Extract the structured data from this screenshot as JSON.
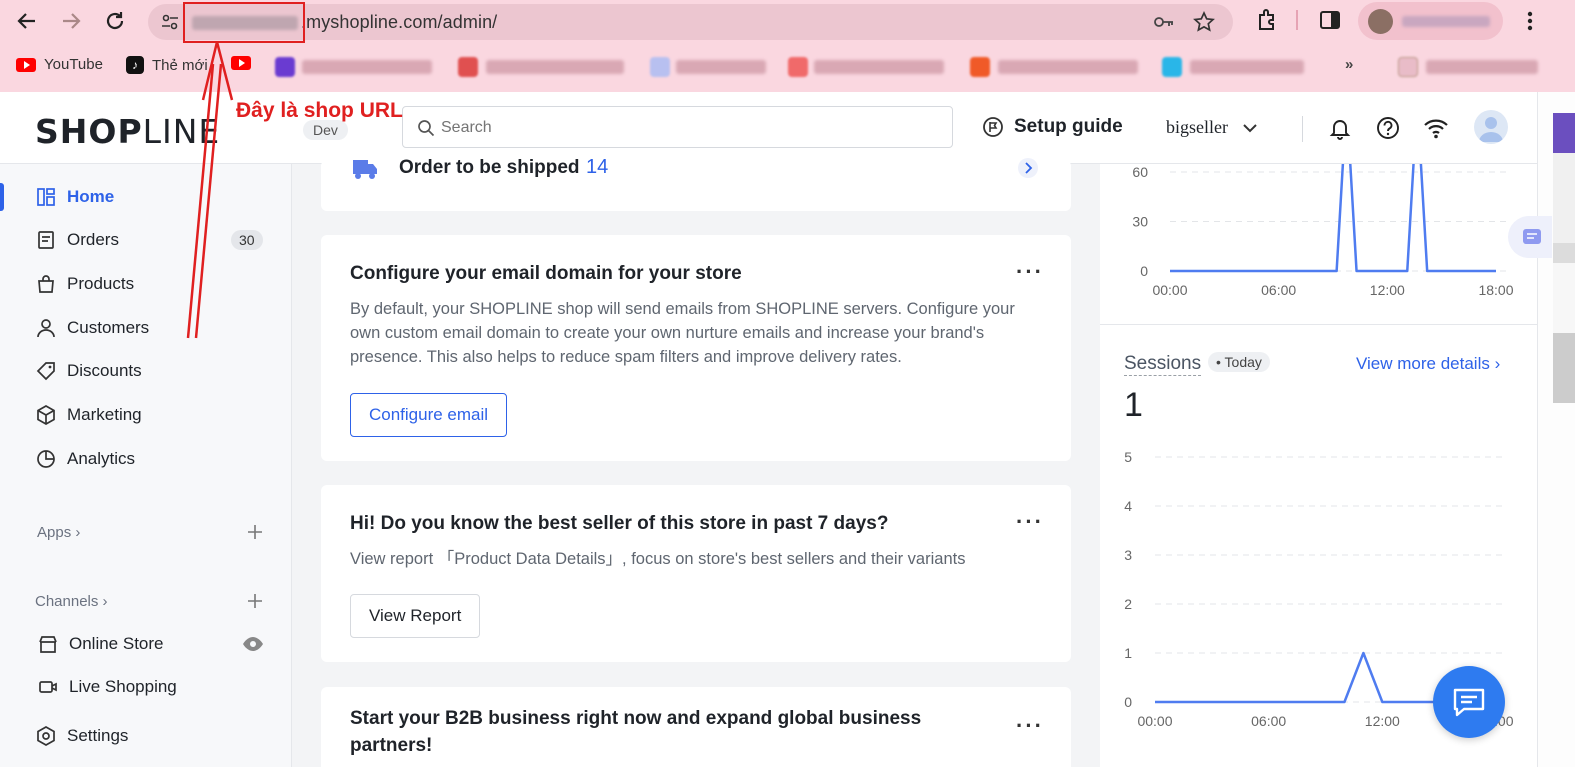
{
  "browser": {
    "url_rest": ".myshopline.com/admin/",
    "bookmarks": [
      {
        "label": "YouTube"
      },
      {
        "label": "Thẻ mới"
      }
    ]
  },
  "annotation": {
    "text": "Đây là shop URL"
  },
  "header": {
    "logo_bold": "SHOP",
    "logo_thin": "LINE",
    "env_tag": "Dev",
    "search_placeholder": "Search",
    "setup_guide": "Setup guide",
    "store_name": "bigseller"
  },
  "sidebar": {
    "items": [
      {
        "label": "Home",
        "icon": "home-icon",
        "active": true
      },
      {
        "label": "Orders",
        "icon": "orders-icon",
        "badge": "30"
      },
      {
        "label": "Products",
        "icon": "products-icon"
      },
      {
        "label": "Customers",
        "icon": "customers-icon"
      },
      {
        "label": "Discounts",
        "icon": "discounts-icon"
      },
      {
        "label": "Marketing",
        "icon": "marketing-icon"
      },
      {
        "label": "Analytics",
        "icon": "analytics-icon"
      }
    ],
    "apps_title": "Apps",
    "channels_title": "Channels",
    "channels": [
      {
        "label": "Online Store",
        "icon": "store-icon"
      },
      {
        "label": "Live Shopping",
        "icon": "live-icon"
      }
    ],
    "settings_label": "Settings"
  },
  "main": {
    "order_card": {
      "label": "Order to be shipped",
      "count": "14"
    },
    "email_card": {
      "title": "Configure your email domain for your store",
      "body": "By default, your SHOPLINE shop will send emails from SHOPLINE servers. Configure your own custom email domain to create your own nurture emails and increase your brand's presence. This also helps to reduce spam filters and improve delivery rates.",
      "button": "Configure email"
    },
    "best_seller_card": {
      "title": "Hi! Do you know the best seller of this store in past 7 days?",
      "body": "View report 「Product Data Details」, focus on store's best sellers and their variants",
      "button": "View Report"
    },
    "b2b_card": {
      "title": "Start your B2B business right now and expand global business partners!"
    }
  },
  "right": {
    "sessions_title": "Sessions",
    "today": "• Today",
    "view_more": "View more details",
    "sessions_value": "1"
  },
  "colors": {
    "accent": "#2e62e8",
    "chrome": "#fad7e0",
    "annotation": "#e02020"
  },
  "chart_data": [
    {
      "type": "line",
      "x": [
        "00:00",
        "06:00",
        "12:00",
        "18:00"
      ],
      "yticks": [
        0,
        30,
        60
      ],
      "series": [
        {
          "values": [
            [
              0,
              0
            ],
            [
              9.2,
              0
            ],
            [
              9.6,
              75
            ],
            [
              9.9,
              75
            ],
            [
              10.3,
              0
            ],
            [
              13.1,
              0
            ],
            [
              13.5,
              75
            ],
            [
              13.8,
              75
            ],
            [
              14.2,
              0
            ],
            [
              18,
              0
            ]
          ]
        }
      ],
      "note_x_unit": "hours"
    },
    {
      "type": "line",
      "x": [
        "00:00",
        "06:00",
        "12:00",
        "18:00"
      ],
      "yticks": [
        0,
        1,
        2,
        3,
        4,
        5
      ],
      "ylim": [
        0,
        5
      ],
      "series": [
        {
          "values": [
            [
              0,
              0
            ],
            [
              10,
              0
            ],
            [
              11,
              1
            ],
            [
              12,
              0
            ],
            [
              18,
              0
            ]
          ]
        }
      ]
    }
  ]
}
